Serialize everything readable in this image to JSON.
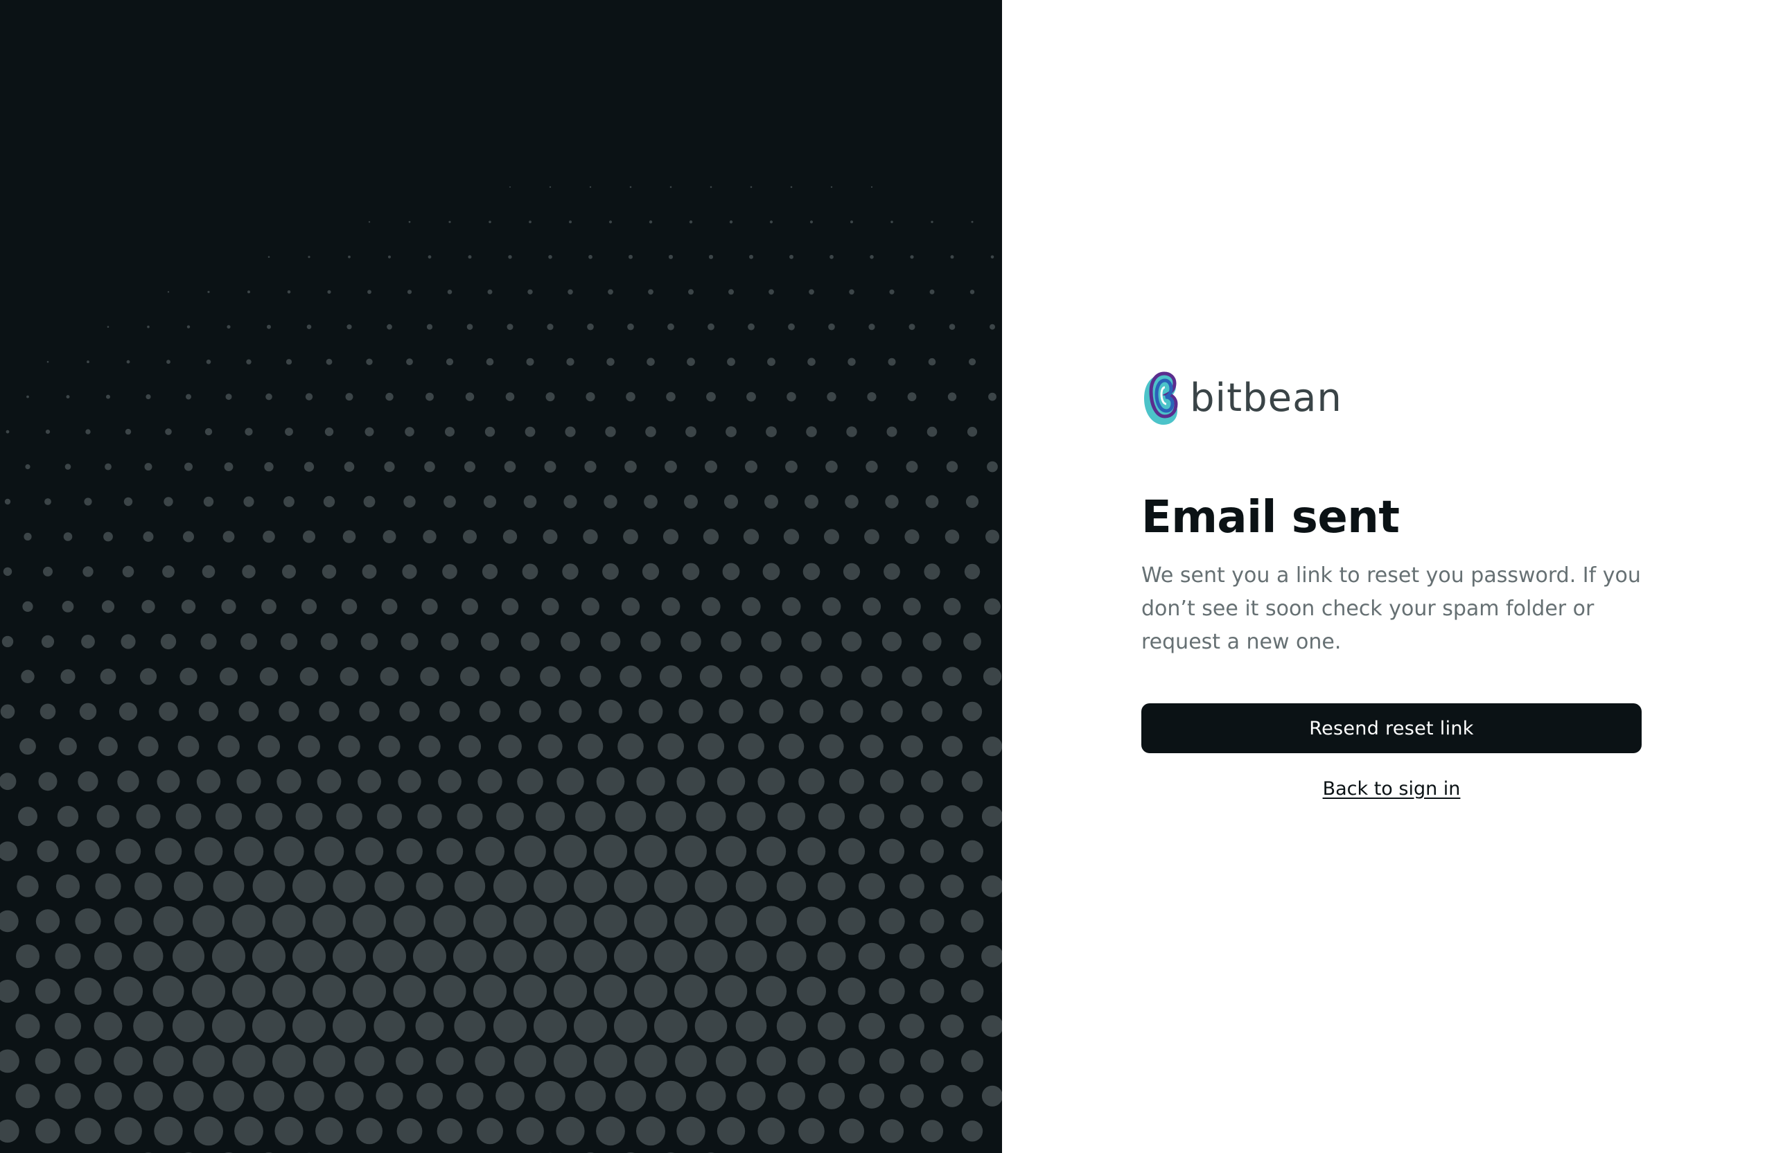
{
  "brand": {
    "name": "bitbean",
    "logo_icon": "bitbean-logo-mark",
    "logo_colors": [
      "#5b2d8e",
      "#2a62b8",
      "#4cc3c9"
    ]
  },
  "art": {
    "background_color": "#0b1215",
    "dot_color": "#3c4548"
  },
  "main": {
    "title": "Email sent",
    "description": "We sent you a link to reset you password. If you don’t see it soon check your spam folder or request a new one.",
    "resend_label": "Resend reset link",
    "back_label": "Back to sign in"
  },
  "colors": {
    "primary": "#0b1215",
    "text_muted": "#667073",
    "logo_text": "#3a4447"
  }
}
